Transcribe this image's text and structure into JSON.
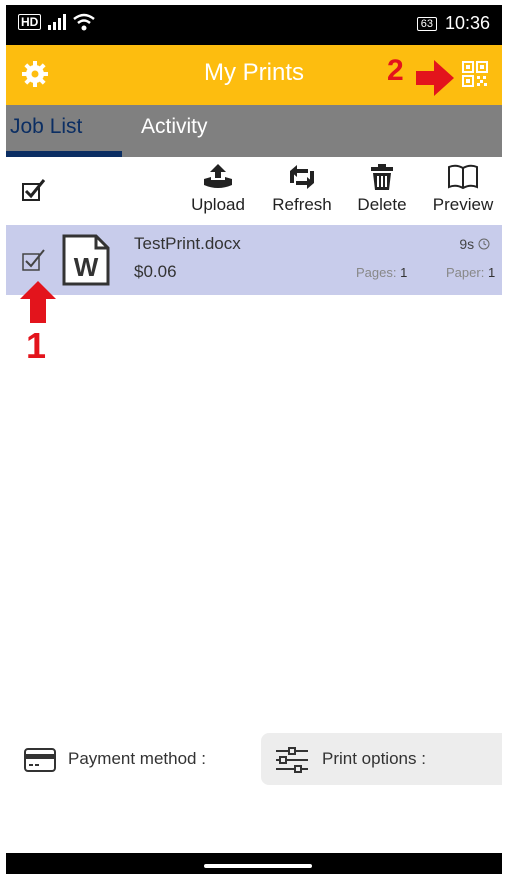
{
  "status_bar": {
    "time": "10:36",
    "battery": "63",
    "network": "HD"
  },
  "app_bar": {
    "title": "My Prints"
  },
  "tabs": [
    {
      "label": "Job List",
      "active": true
    },
    {
      "label": "Activity",
      "active": false
    }
  ],
  "toolbar": {
    "upload_label": "Upload",
    "refresh_label": "Refresh",
    "delete_label": "Delete",
    "preview_label": "Preview"
  },
  "jobs": [
    {
      "name": "TestPrint.docx",
      "price": "$0.06",
      "time": "9s",
      "pages_label": "Pages:",
      "pages": "1",
      "paper_label": "Paper:",
      "paper": "1",
      "selected": true
    }
  ],
  "annotations": {
    "marker1": "1",
    "marker2": "2"
  },
  "bottom": {
    "payment_label": "Payment method :",
    "print_options_label": "Print options :"
  },
  "colors": {
    "appbar": "#FDBD0F",
    "tabs": "#808080",
    "active_tab": "#0b2e63",
    "selected_row": "#C8CCEB",
    "annotation": "#e3141c"
  }
}
